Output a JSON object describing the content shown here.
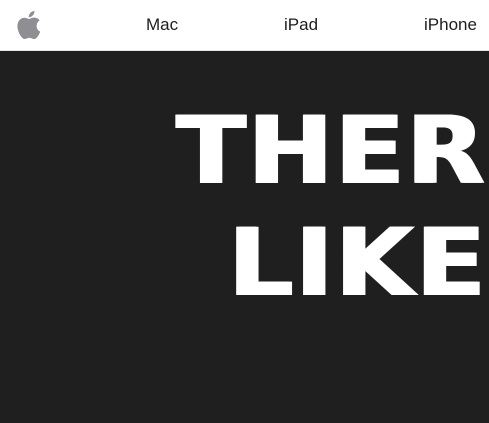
{
  "nav": {
    "logo_icon": "apple-logo-icon",
    "logo_color": "#8e8e93",
    "links": [
      {
        "label": "Mac"
      },
      {
        "label": "iPad"
      },
      {
        "label": "iPhone"
      }
    ]
  },
  "hero": {
    "background": "#1f1f1f",
    "headline_line1": "THERE",
    "headline_line2": "LIKE"
  }
}
